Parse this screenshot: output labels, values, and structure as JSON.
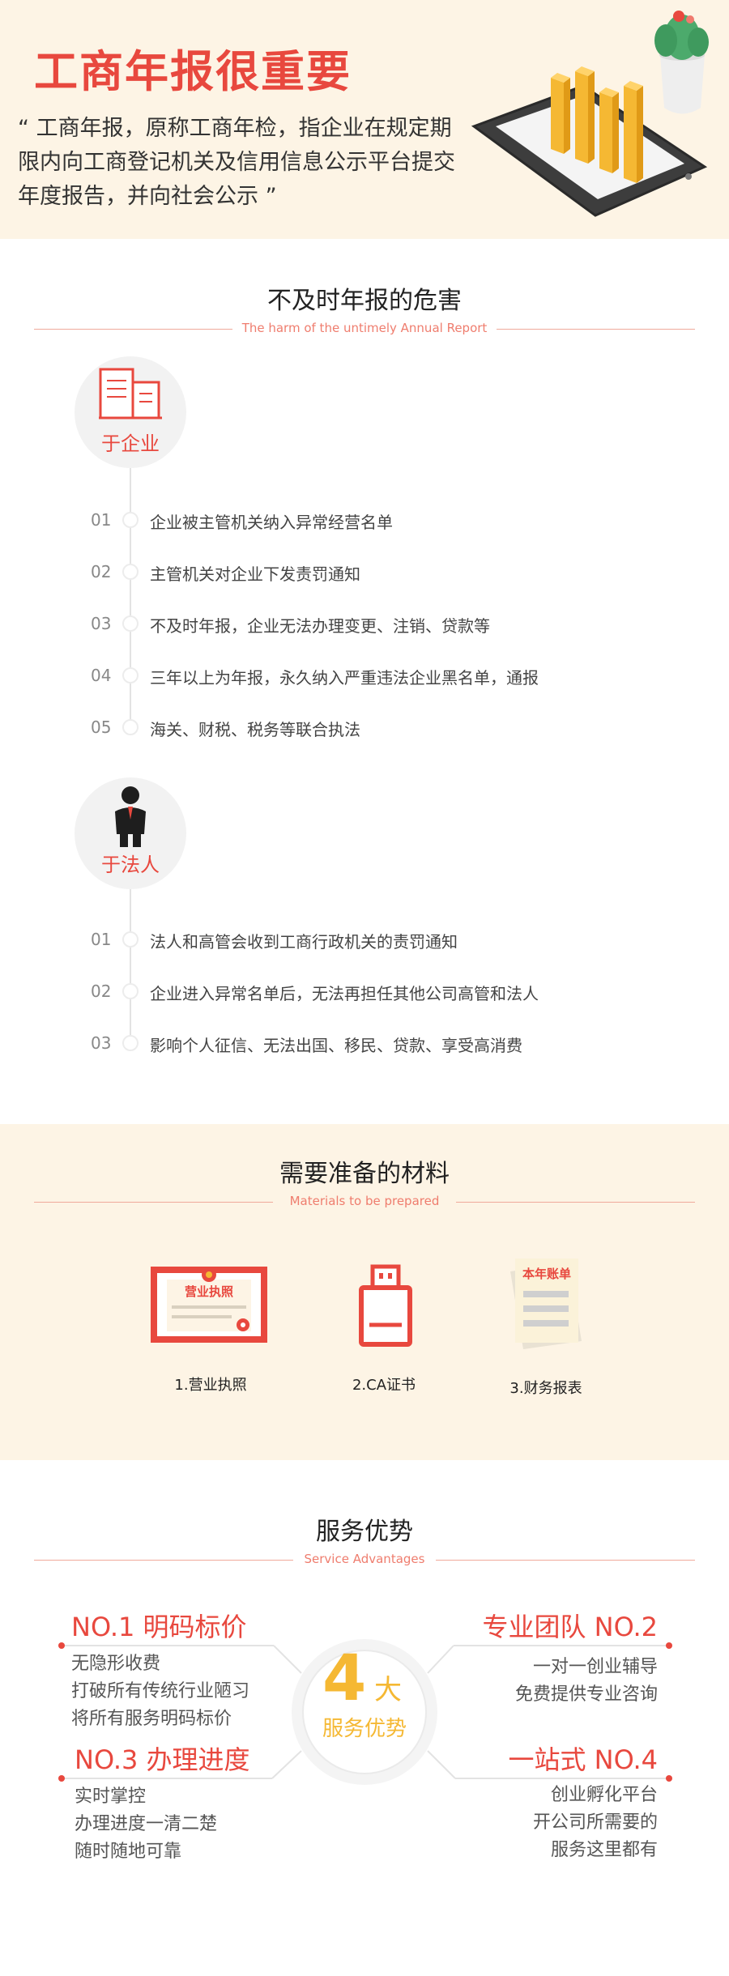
{
  "hero": {
    "title": "工商年报很重要",
    "quote": "“ 工商年报，原称工商年检，指企业在规定期限内向工商登记机关及信用信息公示平台提交年度报告，并向社会公示 ”"
  },
  "harm": {
    "title": "不及时年报的危害",
    "subtitle": "The harm of the untimely Annual Report",
    "enterprise": {
      "label": "于企业",
      "items": [
        {
          "num": "01",
          "text": "企业被主管机关纳入异常经营名单"
        },
        {
          "num": "02",
          "text": "主管机关对企业下发责罚通知"
        },
        {
          "num": "03",
          "text": "不及时年报，企业无法办理变更、注销、贷款等"
        },
        {
          "num": "04",
          "text": "三年以上为年报，永久纳入严重违法企业黑名单，通报"
        },
        {
          "num": "05",
          "text": "海关、财税、税务等联合执法"
        }
      ]
    },
    "legal": {
      "label": "于法人",
      "items": [
        {
          "num": "01",
          "text": "法人和高管会收到工商行政机关的责罚通知"
        },
        {
          "num": "02",
          "text": "企业进入异常名单后，无法再担任其他公司高管和法人"
        },
        {
          "num": "03",
          "text": "影响个人征信、无法出国、移民、贷款、享受高消费"
        }
      ]
    }
  },
  "materials": {
    "title": "需要准备的材料",
    "subtitle": "Materials to be prepared",
    "items": [
      {
        "label": "1.营业执照",
        "icon_text": "营业执照"
      },
      {
        "label": "2.CA证书"
      },
      {
        "label": "3.财务报表",
        "icon_text": "本年账单"
      }
    ]
  },
  "advantages": {
    "title": "服务优势",
    "subtitle": "Service Advantages",
    "center": {
      "number": "4",
      "big": "大",
      "label": "服务优势"
    },
    "items": [
      {
        "title": "NO.1 明码标价",
        "lines": [
          "无隐形收费",
          "打破所有传统行业陋习",
          "将所有服务明码标价"
        ]
      },
      {
        "title": "专业团队 NO.2",
        "lines": [
          "一对一创业辅导",
          "免费提供专业咨询"
        ]
      },
      {
        "title": "NO.3 办理进度",
        "lines": [
          "实时掌控",
          "办理进度一清二楚",
          "随时随地可靠"
        ]
      },
      {
        "title": "一站式 NO.4",
        "lines": [
          "创业孵化平台",
          "开公司所需要的",
          "服务这里都有"
        ]
      }
    ]
  },
  "colors": {
    "accent": "#e8483e",
    "cream": "#fdf4e5",
    "gold": "#f5b833",
    "subtitle": "#ef7d6e"
  }
}
